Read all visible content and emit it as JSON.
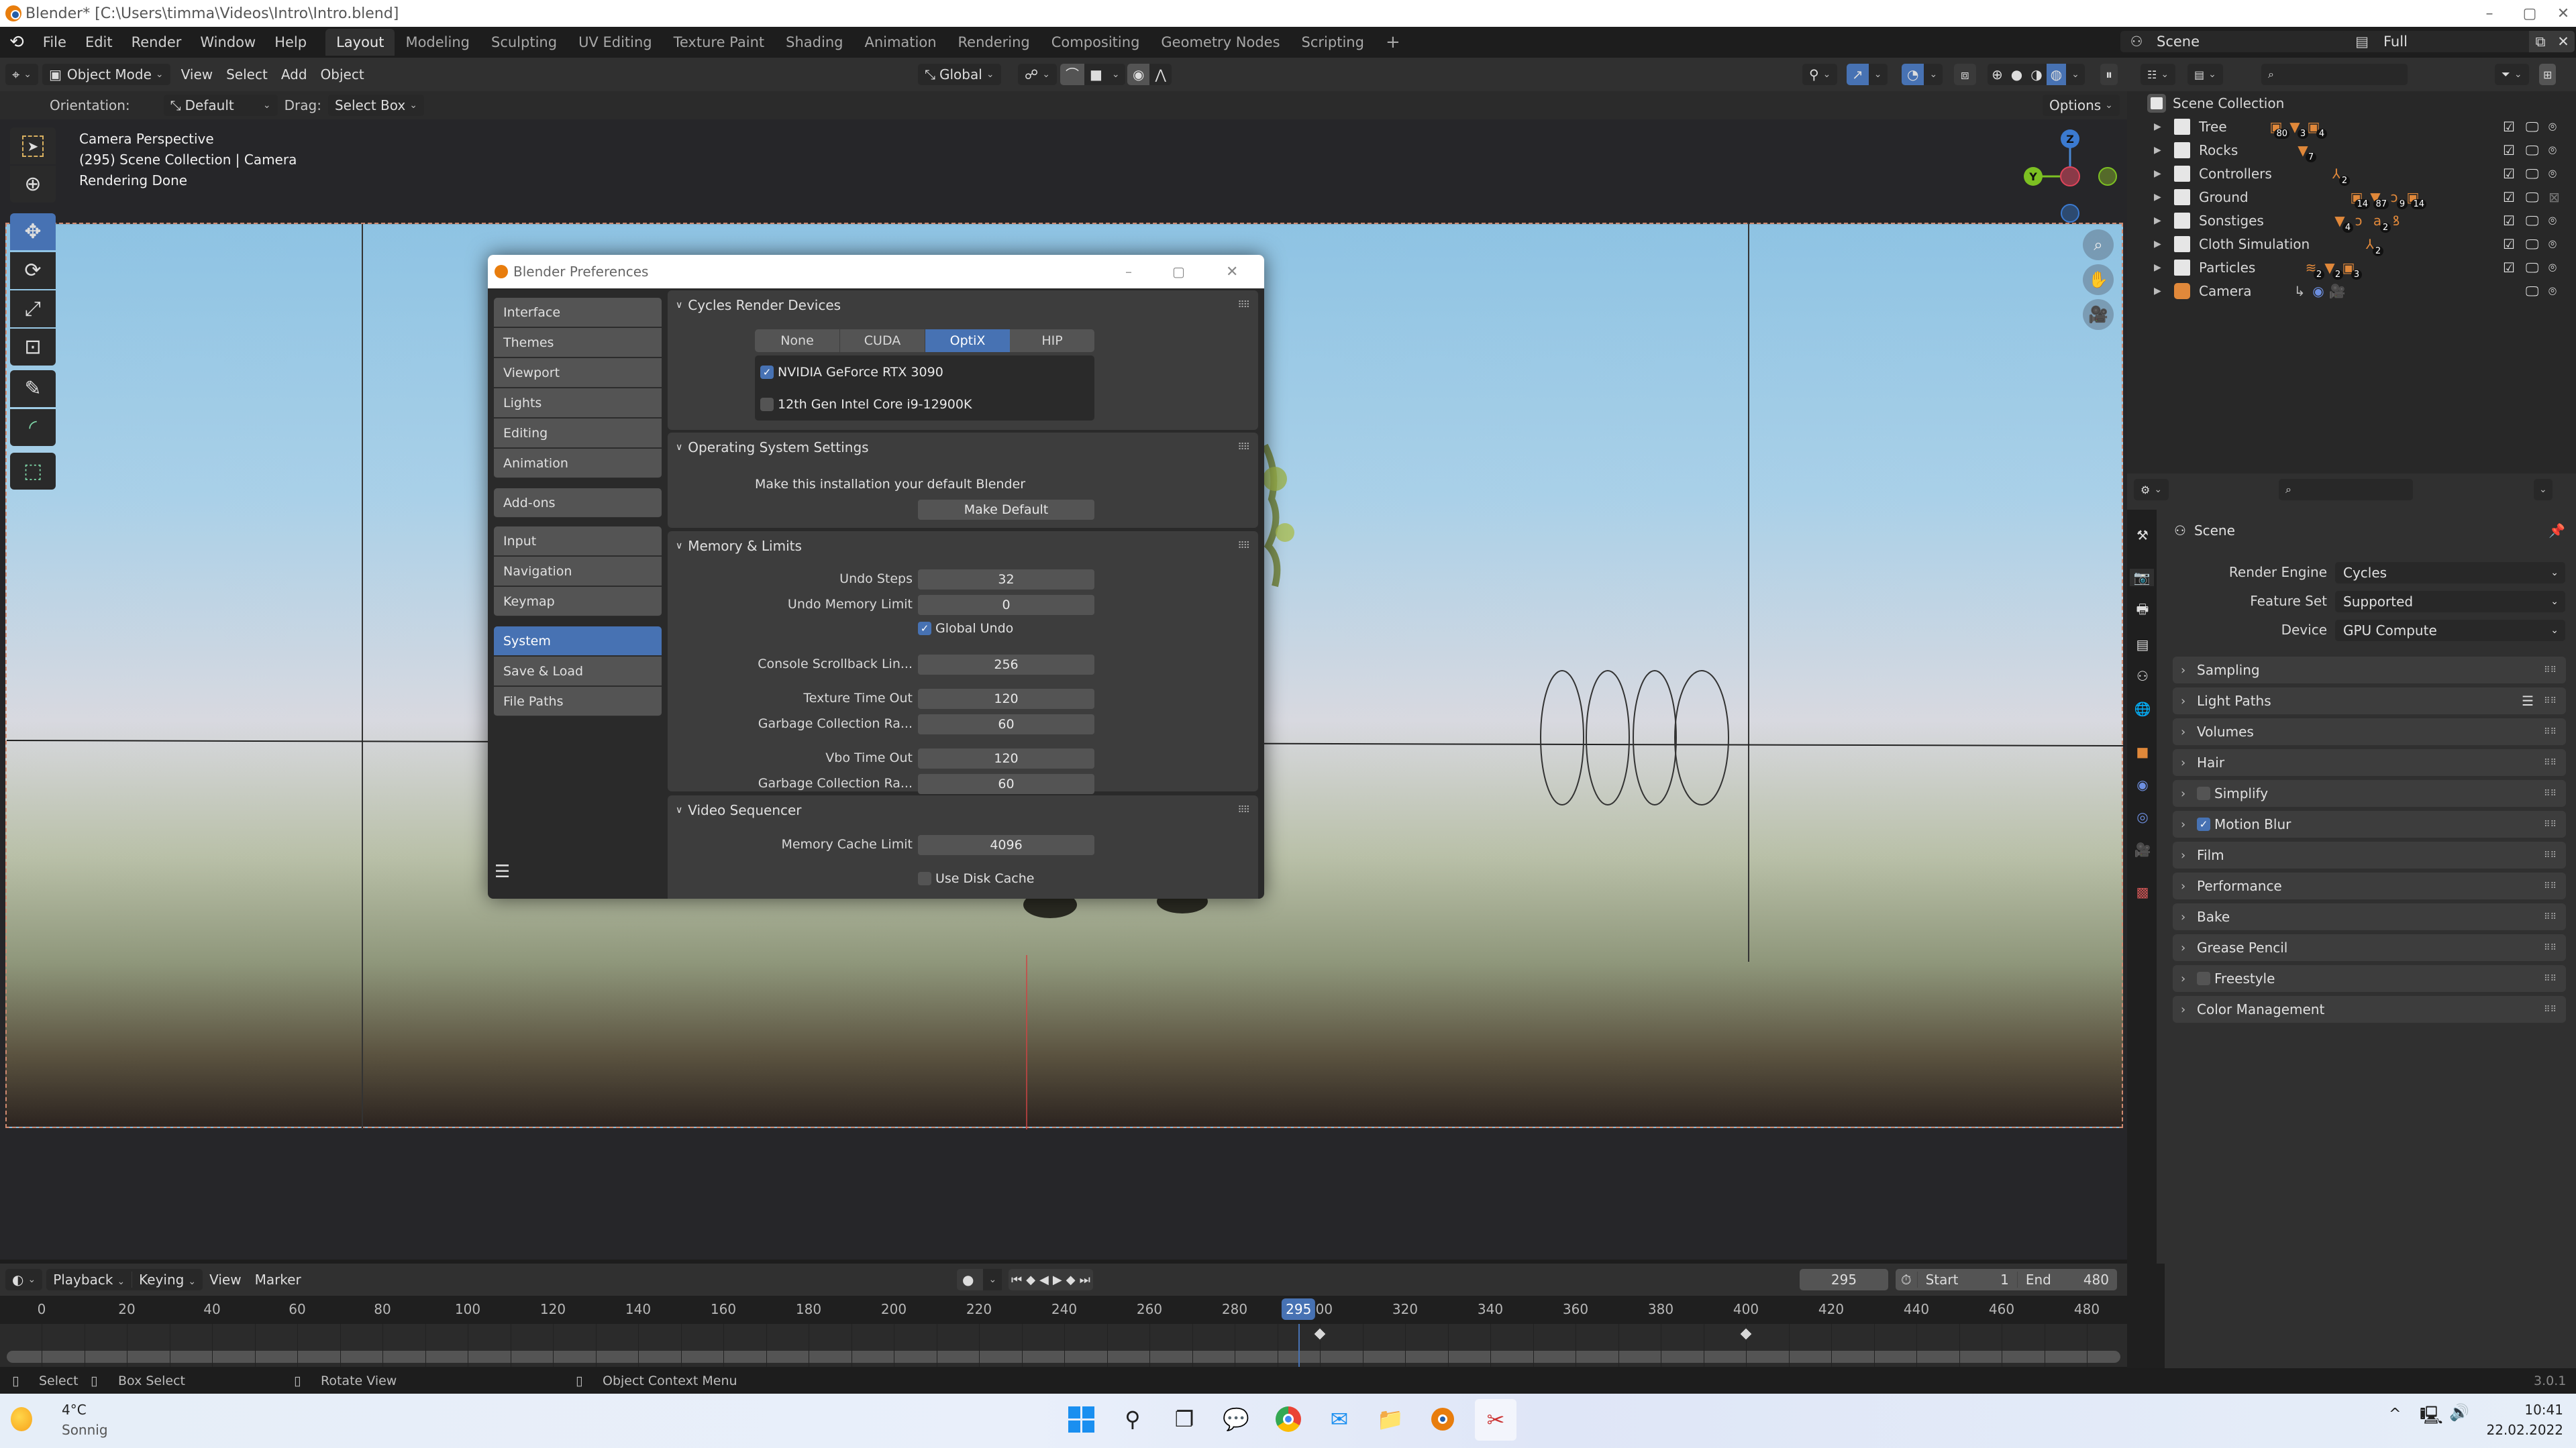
{
  "window": {
    "title": "Blender* [C:\\Users\\timma\\Videos\\Intro\\Intro.blend]",
    "controls": {
      "minimize": "–",
      "maximize": "▢",
      "close": "✕"
    }
  },
  "menubar": {
    "menus": [
      "File",
      "Edit",
      "Render",
      "Window",
      "Help"
    ],
    "workspaces": [
      "Layout",
      "Modeling",
      "Sculpting",
      "UV Editing",
      "Texture Paint",
      "Shading",
      "Animation",
      "Rendering",
      "Compositing",
      "Geometry Nodes",
      "Scripting"
    ],
    "active_workspace": "Layout",
    "add_workspace": "+",
    "scene": "Scene",
    "view_layer": "Full"
  },
  "viewport_header": {
    "mode": "Object Mode",
    "menus": [
      "View",
      "Select",
      "Add",
      "Object"
    ],
    "transform_orientation": "Global",
    "orientation_label": "Orientation:",
    "orientation_value": "Default",
    "drag_label": "Drag:",
    "drag_value": "Select Box",
    "options": "Options"
  },
  "viewport_overlay": {
    "line1": "Camera Perspective",
    "line2": "(295) Scene Collection | Camera",
    "line3": "Rendering Done",
    "gizmo": {
      "z": "Z",
      "y": "Y"
    }
  },
  "preferences": {
    "title": "Blender Preferences",
    "nav_groups": [
      [
        "Interface",
        "Themes",
        "Viewport",
        "Lights",
        "Editing",
        "Animation"
      ],
      [
        "Add-ons"
      ],
      [
        "Input",
        "Navigation",
        "Keymap"
      ],
      [
        "System",
        "Save & Load",
        "File Paths"
      ]
    ],
    "active_nav": "System",
    "cycles": {
      "header": "Cycles Render Devices",
      "tabs": [
        "None",
        "CUDA",
        "OptiX",
        "HIP"
      ],
      "active_tab": "OptiX",
      "devices": [
        {
          "name": "NVIDIA GeForce RTX 3090",
          "checked": true
        },
        {
          "name": "12th Gen Intel Core i9-12900K",
          "checked": false
        }
      ]
    },
    "os": {
      "header": "Operating System Settings",
      "text": "Make this installation your default Blender",
      "button": "Make Default"
    },
    "memory": {
      "header": "Memory & Limits",
      "undo_steps_label": "Undo Steps",
      "undo_steps": "32",
      "undo_mem_label": "Undo Memory Limit",
      "undo_mem": "0",
      "global_undo_label": "Global Undo",
      "global_undo": true,
      "console_label": "Console Scrollback Lin...",
      "console": "256",
      "tex_timeout_label": "Texture Time Out",
      "tex_timeout": "120",
      "gc1_label": "Garbage Collection Ra...",
      "gc1": "60",
      "vbo_timeout_label": "Vbo Time Out",
      "vbo_timeout": "120",
      "gc2_label": "Garbage Collection Ra...",
      "gc2": "60"
    },
    "video": {
      "header": "Video Sequencer",
      "cache_label": "Memory Cache Limit",
      "cache": "4096",
      "disk_cache_label": "Use Disk Cache",
      "disk_cache": false
    }
  },
  "outliner": {
    "root": "Scene Collection",
    "items": [
      {
        "name": "Tree",
        "badges": [
          [
            "▣",
            "80"
          ],
          [
            "▼",
            "3"
          ],
          [
            "▣",
            "4"
          ]
        ]
      },
      {
        "name": "Rocks",
        "badges": [
          [
            "▼",
            "7"
          ]
        ]
      },
      {
        "name": "Controllers",
        "badges": [
          [
            "⅄",
            "2"
          ]
        ]
      },
      {
        "name": "Ground",
        "badges": [
          [
            "▣",
            "14"
          ],
          [
            "▼",
            "87"
          ],
          [
            "ↄ",
            "9"
          ],
          [
            "▣",
            "14"
          ]
        ]
      },
      {
        "name": "Sonstiges",
        "badges": [
          [
            "▼",
            "4"
          ],
          [
            "ↄ",
            ""
          ],
          [
            "a",
            "2"
          ],
          [
            "ꝸ",
            ""
          ]
        ]
      },
      {
        "name": "Cloth Simulation",
        "badges": [
          [
            "⅄",
            "2"
          ]
        ]
      },
      {
        "name": "Particles",
        "badges": [
          [
            "≋",
            "2"
          ],
          [
            "▼",
            "2"
          ],
          [
            "▣",
            "3"
          ]
        ]
      },
      {
        "name": "Camera",
        "badges": [
          [
            "↳",
            ""
          ],
          [
            "◉",
            ""
          ],
          [
            "🎥",
            ""
          ]
        ]
      }
    ]
  },
  "properties": {
    "context": "Scene",
    "render_engine_label": "Render Engine",
    "render_engine": "Cycles",
    "feature_set_label": "Feature Set",
    "feature_set": "Supported",
    "device_label": "Device",
    "device": "GPU Compute",
    "sections": [
      {
        "label": "Sampling"
      },
      {
        "label": "Light Paths",
        "presets": true
      },
      {
        "label": "Volumes"
      },
      {
        "label": "Hair"
      },
      {
        "label": "Simplify",
        "checkbox": false
      },
      {
        "label": "Motion Blur",
        "checkbox": true
      },
      {
        "label": "Film"
      },
      {
        "label": "Performance"
      },
      {
        "label": "Bake"
      },
      {
        "label": "Grease Pencil"
      },
      {
        "label": "Freestyle",
        "checkbox": false
      },
      {
        "label": "Color Management"
      }
    ]
  },
  "timeline": {
    "menus": [
      "Playback",
      "Keying",
      "View",
      "Marker"
    ],
    "current_frame": "295",
    "start_label": "Start",
    "start": "1",
    "end_label": "End",
    "end": "480",
    "ticks": [
      "0",
      "20",
      "40",
      "60",
      "80",
      "100",
      "120",
      "140",
      "160",
      "180",
      "200",
      "220",
      "240",
      "260",
      "280",
      "300",
      "320",
      "340",
      "360",
      "380",
      "400",
      "420",
      "440",
      "460",
      "480"
    ],
    "keyframes": [
      300,
      400
    ],
    "playhead_frame": 295
  },
  "statusbar": {
    "select": "Select",
    "box_select": "Box Select",
    "rotate": "Rotate View",
    "context_menu": "Object Context Menu",
    "version": "3.0.1"
  },
  "taskbar": {
    "weather_temp": "4°C",
    "weather_desc": "Sonnig",
    "time": "10:41",
    "date": "22.02.2022"
  }
}
